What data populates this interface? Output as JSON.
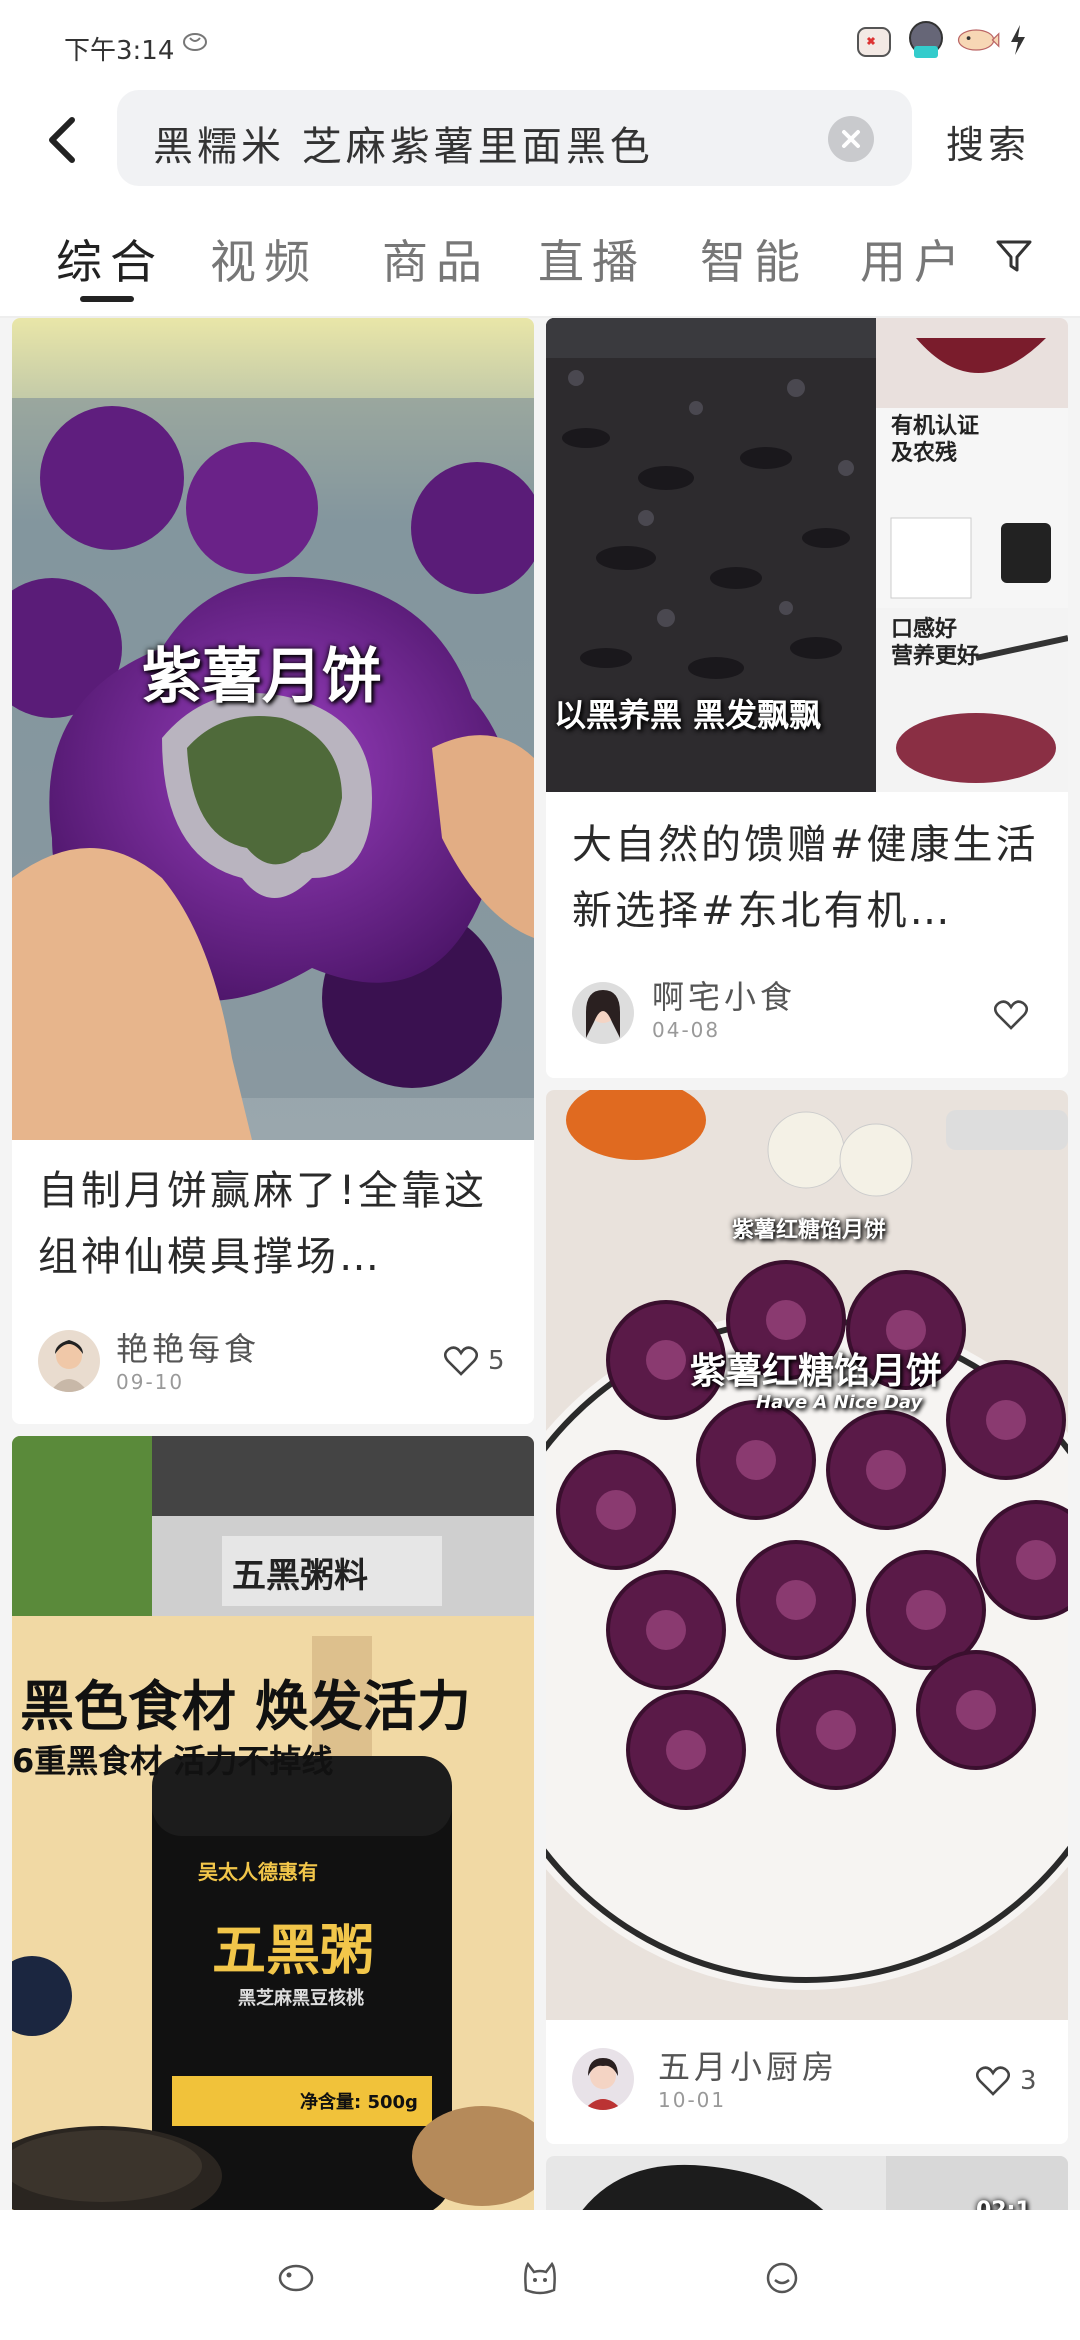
{
  "status_bar": {
    "time": "下午3:14",
    "icons": [
      "cat-sticker-icon",
      "cat-sticker-icon",
      "fish-sticker-icon",
      "charging-icon"
    ]
  },
  "search": {
    "query": "黑糯米 芝麻紫薯里面黑色",
    "submit_label": "搜索"
  },
  "tabs": [
    {
      "label": "综合",
      "active": true
    },
    {
      "label": "视频"
    },
    {
      "label": "商品"
    },
    {
      "label": "直播"
    },
    {
      "label": "智能"
    },
    {
      "label": "用户"
    }
  ],
  "feed": {
    "cards": [
      {
        "image_caption": "紫薯月饼",
        "title": "自制月饼赢麻了!全靠这组神仙模具撑场…",
        "author": "艳艳每食",
        "date": "09-10",
        "likes": "5"
      },
      {
        "image_caption": "以黑养黑 黑发飘飘",
        "image_side_labels": [
          "有机认证及农残",
          "口感好营养更好"
        ],
        "title": "大自然的馈赠#健康生活新选择#东北有机…",
        "author": "啊宅小食",
        "date": "04-08",
        "likes": ""
      },
      {
        "image_caption": "紫薯红糖馅月饼",
        "image_subcaption": "Have A Nice Day",
        "image_top_label": "紫薯红糖馅月饼",
        "title": "",
        "author": "五月小厨房",
        "date": "10-01",
        "likes": "3"
      },
      {
        "image_heading": "黑色食材 焕发活力",
        "image_subheading": "6重黑食材 活力不掉线",
        "image_sign": "五黑粥料",
        "product_brand": "吴太人德惠有",
        "product_name": "五黑粥",
        "product_desc": "黑芝麻黑豆核桃",
        "product_weight": "净含量: 500g"
      },
      {
        "video_duration": "02:1"
      }
    ]
  },
  "colors": {
    "accent": "#222222",
    "purple": "#6a1f8a"
  }
}
